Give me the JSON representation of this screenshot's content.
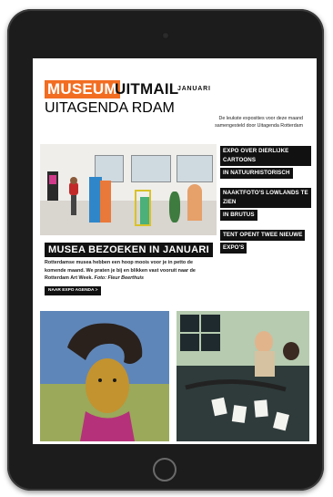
{
  "newsletter": {
    "logo_museum": "MUSEUM",
    "logo_uitmail": "UITMAIL",
    "month": "JANUARI",
    "sublogo": "UITAGENDA RDAM",
    "intro_line1": "De leukste exposities voor deze maand",
    "intro_line2": "samengesteld door Uitagenda Rotterdam"
  },
  "side_items": [
    [
      "EXPO OVER DIERLIJKE CARTOONS",
      "IN NATUURHISTORISCH"
    ],
    [
      "NAAKTFOTO'S LOWLANDS TE ZIEN",
      "IN BRUTUS"
    ],
    [
      "TENT OPENT TWEE NIEUWE",
      "EXPO'S"
    ]
  ],
  "article": {
    "title": "MUSEA BEZOEKEN IN JANUARI",
    "body_line1": "Rotterdamse musea hebben een hoop moois voor je in petto de",
    "body_line2": "komende maand. We praten je bij en blikken vast vooruit naar de",
    "body_line3": "Rotterdam Art Week.",
    "photo_credit": "Foto: Fleur Beerthuis",
    "cta": "NAAR EXPO AGENDA  >"
  },
  "colors": {
    "brand_orange": "#f26d21",
    "ink": "#111111"
  }
}
